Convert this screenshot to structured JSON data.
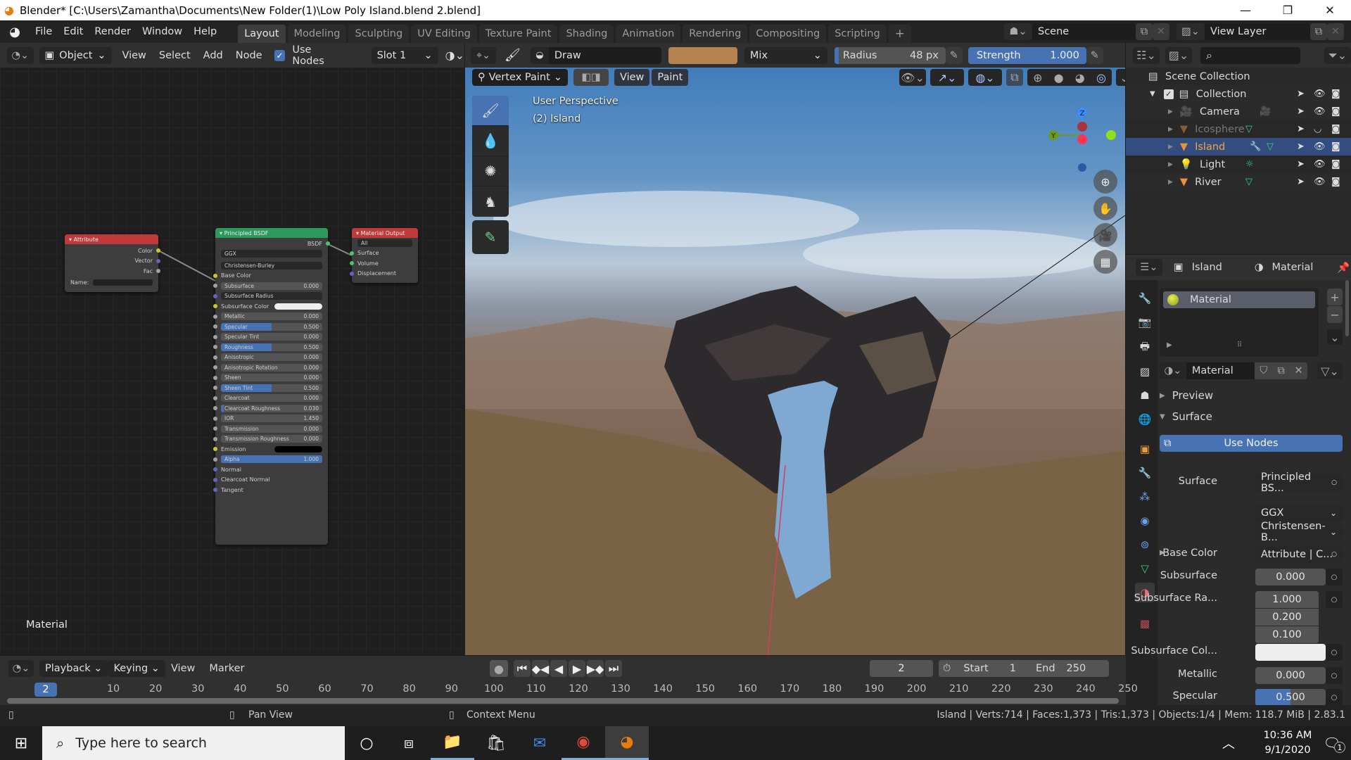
{
  "window": {
    "title": "Blender* [C:\\Users\\Zamantha\\Documents\\New Folder(1)\\Low Poly Island.blend 2.blend]",
    "controls": {
      "minimize": "—",
      "maximize": "❐",
      "close": "✕"
    }
  },
  "topbar": {
    "menus": [
      "File",
      "Edit",
      "Render",
      "Window",
      "Help"
    ],
    "workspaces": [
      "Layout",
      "Modeling",
      "Sculpting",
      "UV Editing",
      "Texture Paint",
      "Shading",
      "Animation",
      "Rendering",
      "Compositing",
      "Scripting"
    ],
    "active_workspace": "Layout",
    "add_workspace": "+",
    "scene": "Scene",
    "view_layer": "View Layer"
  },
  "node_editor": {
    "header": {
      "mode": "Object",
      "menus": [
        "View",
        "Select",
        "Add",
        "Node"
      ],
      "use_nodes_label": "Use Nodes",
      "use_nodes_checked": true,
      "slot": "Slot 1"
    },
    "material_label": "Material",
    "nodes": {
      "attribute": {
        "title": "Attribute",
        "color": "#c13a3a",
        "outputs": [
          "Color",
          "Vector",
          "Fac"
        ],
        "name_label": "Name:",
        "name_value": ""
      },
      "principled": {
        "title": "Principled BSDF",
        "color": "#2d9a5c",
        "output": "BSDF",
        "distribution": "GGX",
        "subsurface_method": "Christensen-Burley",
        "inputs": [
          {
            "label": "Base Color",
            "type": "socket"
          },
          {
            "label": "Subsurface",
            "value": "0.000",
            "fill": 0
          },
          {
            "label": "Subsurface Radius",
            "type": "dropdown"
          },
          {
            "label": "Subsurface Color",
            "type": "color",
            "color": "#eeeeee"
          },
          {
            "label": "Metallic",
            "value": "0.000",
            "fill": 0
          },
          {
            "label": "Specular",
            "value": "0.500",
            "fill": 0.5
          },
          {
            "label": "Specular Tint",
            "value": "0.000",
            "fill": 0
          },
          {
            "label": "Roughness",
            "value": "0.500",
            "fill": 0.5
          },
          {
            "label": "Anisotropic",
            "value": "0.000",
            "fill": 0
          },
          {
            "label": "Anisotropic Rotation",
            "value": "0.000",
            "fill": 0
          },
          {
            "label": "Sheen",
            "value": "0.000",
            "fill": 0
          },
          {
            "label": "Sheen Tint",
            "value": "0.500",
            "fill": 0.5
          },
          {
            "label": "Clearcoat",
            "value": "0.000",
            "fill": 0
          },
          {
            "label": "Clearcoat Roughness",
            "value": "0.030",
            "fill": 0.03
          },
          {
            "label": "IOR",
            "value": "1.450",
            "fill": 0
          },
          {
            "label": "Transmission",
            "value": "0.000",
            "fill": 0
          },
          {
            "label": "Transmission Roughness",
            "value": "0.000",
            "fill": 0
          },
          {
            "label": "Emission",
            "type": "color",
            "color": "#000000"
          },
          {
            "label": "Alpha",
            "value": "1.000",
            "fill": 1
          },
          {
            "label": "Normal",
            "type": "socket"
          },
          {
            "label": "Clearcoat Normal",
            "type": "socket"
          },
          {
            "label": "Tangent",
            "type": "socket"
          }
        ]
      },
      "output": {
        "title": "Material Output",
        "color": "#c13a3a",
        "target": "All",
        "inputs": [
          "Surface",
          "Volume",
          "Displacement"
        ]
      }
    }
  },
  "paint_header": {
    "brush": "Draw",
    "brush_color": "#b5834f",
    "blend": "Mix",
    "radius_label": "Radius",
    "radius_value": "48 px",
    "strength_label": "Strength",
    "strength_value": "1.000",
    "strength_fill": 1.0
  },
  "viewport": {
    "mode": "Vertex Paint",
    "menus": [
      "View",
      "Paint"
    ],
    "overlay_line1": "User Perspective",
    "overlay_line2": "(2) Island",
    "tools": [
      "Draw",
      "Blur",
      "Average",
      "Smear",
      "Annotate"
    ],
    "active_tool": "Draw",
    "gizmo": {
      "z": "Z",
      "y": "Y",
      "x": "X"
    }
  },
  "outliner": {
    "root": "Scene Collection",
    "collection": "Collection",
    "objects": [
      {
        "name": "Camera",
        "data_icon": "camera-data",
        "selected": false,
        "visible": true
      },
      {
        "name": "Icosphere",
        "data_icon": "mesh-data",
        "selected": false,
        "visible": false
      },
      {
        "name": "Island",
        "data_icon": "mesh-data",
        "has_modifier": true,
        "selected": true,
        "visible": true
      },
      {
        "name": "Light",
        "data_icon": "light-data",
        "selected": false,
        "visible": true
      },
      {
        "name": "River",
        "data_icon": "mesh-data",
        "selected": false,
        "visible": true
      }
    ]
  },
  "properties": {
    "object": "Island",
    "context": "Material",
    "slots": [
      "Material"
    ],
    "material_name": "Material",
    "panels": {
      "preview": "Preview",
      "surface": "Surface"
    },
    "use_nodes": "Use Nodes",
    "rows": [
      {
        "label": "Surface",
        "value": "Principled BS...",
        "kind": "link"
      },
      {
        "label": "",
        "value": "GGX",
        "kind": "dropdown"
      },
      {
        "label": "",
        "value": "Christensen-B...",
        "kind": "dropdown"
      },
      {
        "label": "Base Color",
        "value": "Attribute | C...",
        "kind": "link"
      },
      {
        "label": "Subsurface",
        "value": "0.000",
        "kind": "number",
        "fill": 0
      },
      {
        "label": "Subsurface Ra...",
        "values": [
          "1.000",
          "0.200",
          "0.100"
        ],
        "kind": "vector"
      },
      {
        "label": "Subsurface Col...",
        "value": "#eeeeee",
        "kind": "color"
      },
      {
        "label": "Metallic",
        "value": "0.000",
        "kind": "number",
        "fill": 0
      },
      {
        "label": "Specular",
        "value": "0.500",
        "kind": "number",
        "fill": 0.5
      }
    ]
  },
  "timeline": {
    "menus": [
      "Playback",
      "Keying",
      "View",
      "Marker"
    ],
    "current_frame": "2",
    "start_label": "Start",
    "start": "1",
    "end_label": "End",
    "end": "250",
    "ticks": [
      "10",
      "20",
      "30",
      "40",
      "50",
      "60",
      "70",
      "80",
      "90",
      "100",
      "110",
      "120",
      "130",
      "140",
      "150",
      "160",
      "170",
      "180",
      "190",
      "200",
      "210",
      "220",
      "230",
      "240",
      "250"
    ]
  },
  "statusbar": {
    "middle_hint": "Pan View",
    "right_hint": "Context Menu",
    "stats": "Island | Verts:714 | Faces:1,373 | Tris:1,373 | Objects:1/4 | Mem: 118.7 MiB | 2.83.1"
  },
  "taskbar": {
    "search_placeholder": "Type here to search",
    "time": "10:36 AM",
    "date": "9/1/2020",
    "notifications": "1"
  }
}
